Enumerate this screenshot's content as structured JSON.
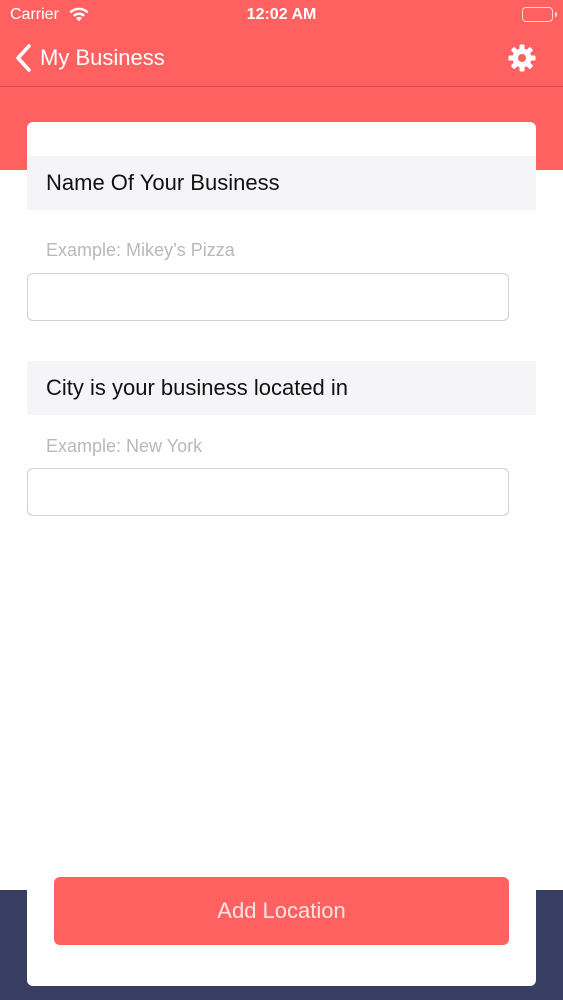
{
  "status_bar": {
    "carrier": "Carrier",
    "time": "12:02 AM"
  },
  "nav": {
    "back_label": "My Business",
    "back_icon": "chevron-left-icon",
    "settings_icon": "gear-icon"
  },
  "form": {
    "business_name": {
      "header": "Name Of Your Business",
      "hint": "Example: Mikey’s Pizza",
      "value": ""
    },
    "city": {
      "header": "City is your business located in",
      "hint": "Example: New York",
      "value": ""
    }
  },
  "actions": {
    "add_location_label": "Add Location"
  },
  "colors": {
    "accent": "#fe615f",
    "footer": "#393f62",
    "section_bg": "#f5f5f7",
    "hint_text": "#b8b8bd"
  }
}
